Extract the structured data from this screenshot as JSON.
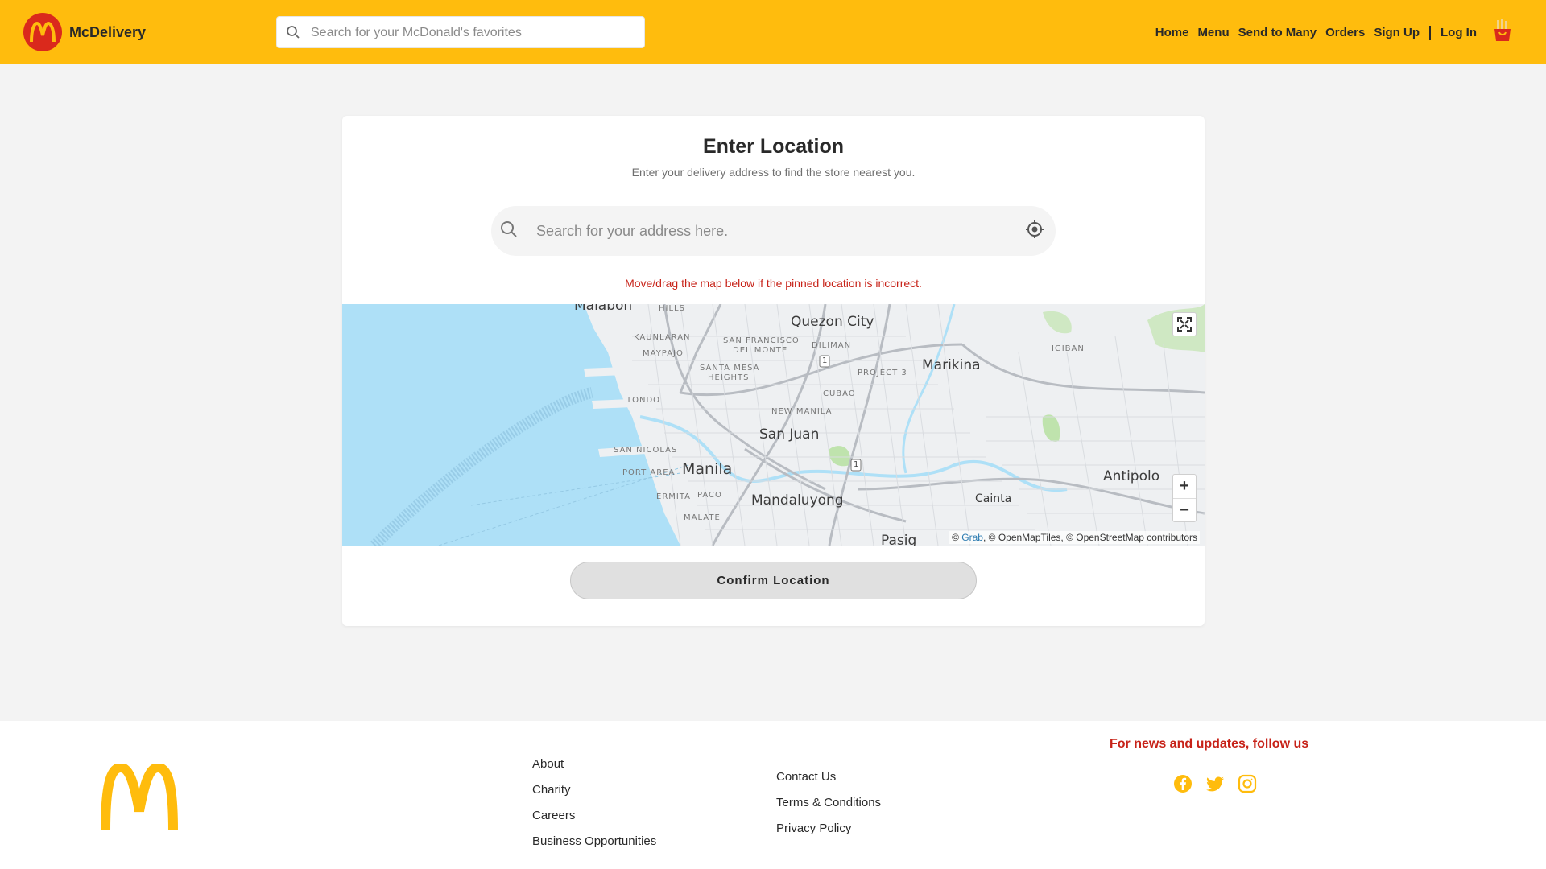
{
  "header": {
    "brand": "McDelivery",
    "search_placeholder": "Search for your McDonald's favorites",
    "nav": {
      "home": "Home",
      "menu": "Menu",
      "send_to_many": "Send to Many",
      "orders": "Orders",
      "sign_up": "Sign Up",
      "log_in": "Log In"
    }
  },
  "location_card": {
    "title": "Enter Location",
    "subtitle": "Enter your delivery address to find the store nearest you.",
    "address_placeholder": "Search for your address here.",
    "hint": "Move/drag the map below if the pinned location is incorrect.",
    "confirm_label": "Confirm Location"
  },
  "map": {
    "labels_major": [
      "Malabon",
      "Quezon City",
      "Marikina",
      "San Juan",
      "Manila",
      "Mandaluyong",
      "Antipolo",
      "Cainta",
      "Pasig"
    ],
    "labels_minor": [
      "HILLS",
      "KAUNLARAN",
      "SAN FRANCISCO",
      "DEL MONTE",
      "DILIMAN",
      "MAYPAJO",
      "SANTA MESA",
      "HEIGHTS",
      "PROJECT 3",
      "IGIBAN",
      "TONDO",
      "CUBAO",
      "NEW MANILA",
      "SAN NICOLAS",
      "PORT AREA",
      "ERMITA",
      "PACO",
      "MALATE"
    ],
    "road_shield": "1",
    "zoom_in": "+",
    "zoom_out": "−",
    "attribution": {
      "prefix": "© ",
      "link": "Grab",
      "suffix": ", © OpenMapTiles, © OpenStreetMap contributors"
    }
  },
  "footer": {
    "col1": [
      "About",
      "Charity",
      "Careers",
      "Business Opportunities"
    ],
    "col2": [
      "Contact Us",
      "Terms & Conditions",
      "Privacy Policy"
    ],
    "follow_text": "For news and updates, follow us",
    "social_icons": [
      "facebook-icon",
      "twitter-icon",
      "instagram-icon"
    ]
  },
  "colors": {
    "header_bg": "#ffbc0d",
    "brand_red": "#da291c",
    "hint_red": "#c72218",
    "water": "#aee0f7"
  }
}
